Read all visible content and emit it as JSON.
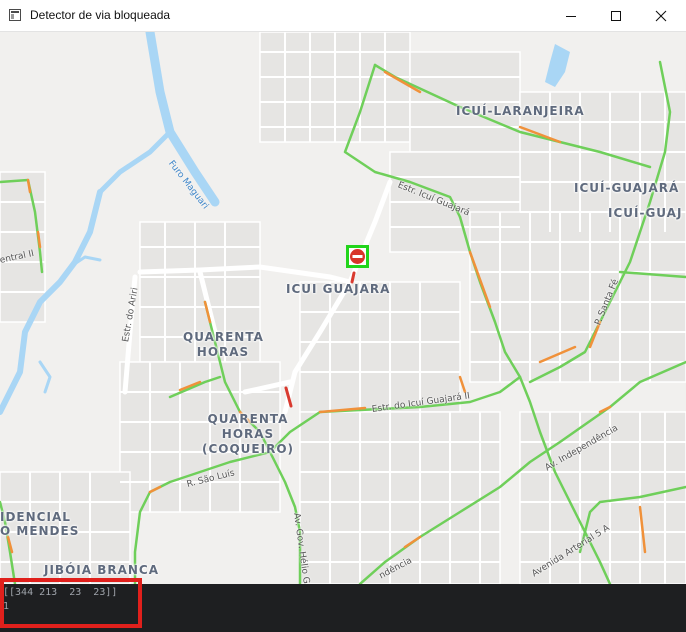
{
  "window": {
    "title": "Detector de via bloqueada",
    "app_icon": "window-app-icon",
    "controls": [
      {
        "name": "minimize-icon"
      },
      {
        "name": "maximize-icon"
      },
      {
        "name": "close-icon"
      }
    ]
  },
  "map": {
    "neighborhoods": {
      "icui_laranjeira": "ICUÍ-LARANJEIRA",
      "icui_guajara_e": "ICUÍ-GUAJARÁ",
      "icui_guajara_e2": "ICUÍ-GUAJ",
      "icui_guajara_c": "ICUI GUAJARA",
      "quarenta_horas_1": "QUARENTA",
      "quarenta_horas_2": "HORAS",
      "quarenta_horas_c1": "QUARENTA",
      "quarenta_horas_c2": "HORAS",
      "quarenta_horas_c3": "(COQUEIRO)",
      "jiboia_branca": "JIBÓIA BRANCA",
      "indencial": "IDENCIAL",
      "o_mendes": "O MENDES"
    },
    "streets": {
      "furo_maguari": "Furo Maguari",
      "estr_icui_guajara": "Estr. Icuí Guajará",
      "estr_ariri": "Estr. do Ariri",
      "estr_icui_guajara_ii": "Estr. do Icuí Guajará II",
      "r_sao_luis": "R. São Luís",
      "av_independencia": "Av. Independência",
      "p_santa_fe": "P. Santa Fé",
      "avenida_arterial": "Avenida Arterial 5 A",
      "av_gov_helio": "Av. Gov. Hélio Gu",
      "entral": "entral II",
      "independencia_bottom": "ndência"
    },
    "detection": {
      "icon": "no-entry-icon",
      "box_color": "#22d51b"
    },
    "colors": {
      "traffic_free": "#6fcf5a",
      "traffic_slow": "#f0913a",
      "traffic_blocked": "#d93a2f",
      "water": "#a9d6f5"
    }
  },
  "console": {
    "line1": "[[344 213  23  23]]",
    "line2": "1",
    "highlight_color": "#e0201c"
  }
}
